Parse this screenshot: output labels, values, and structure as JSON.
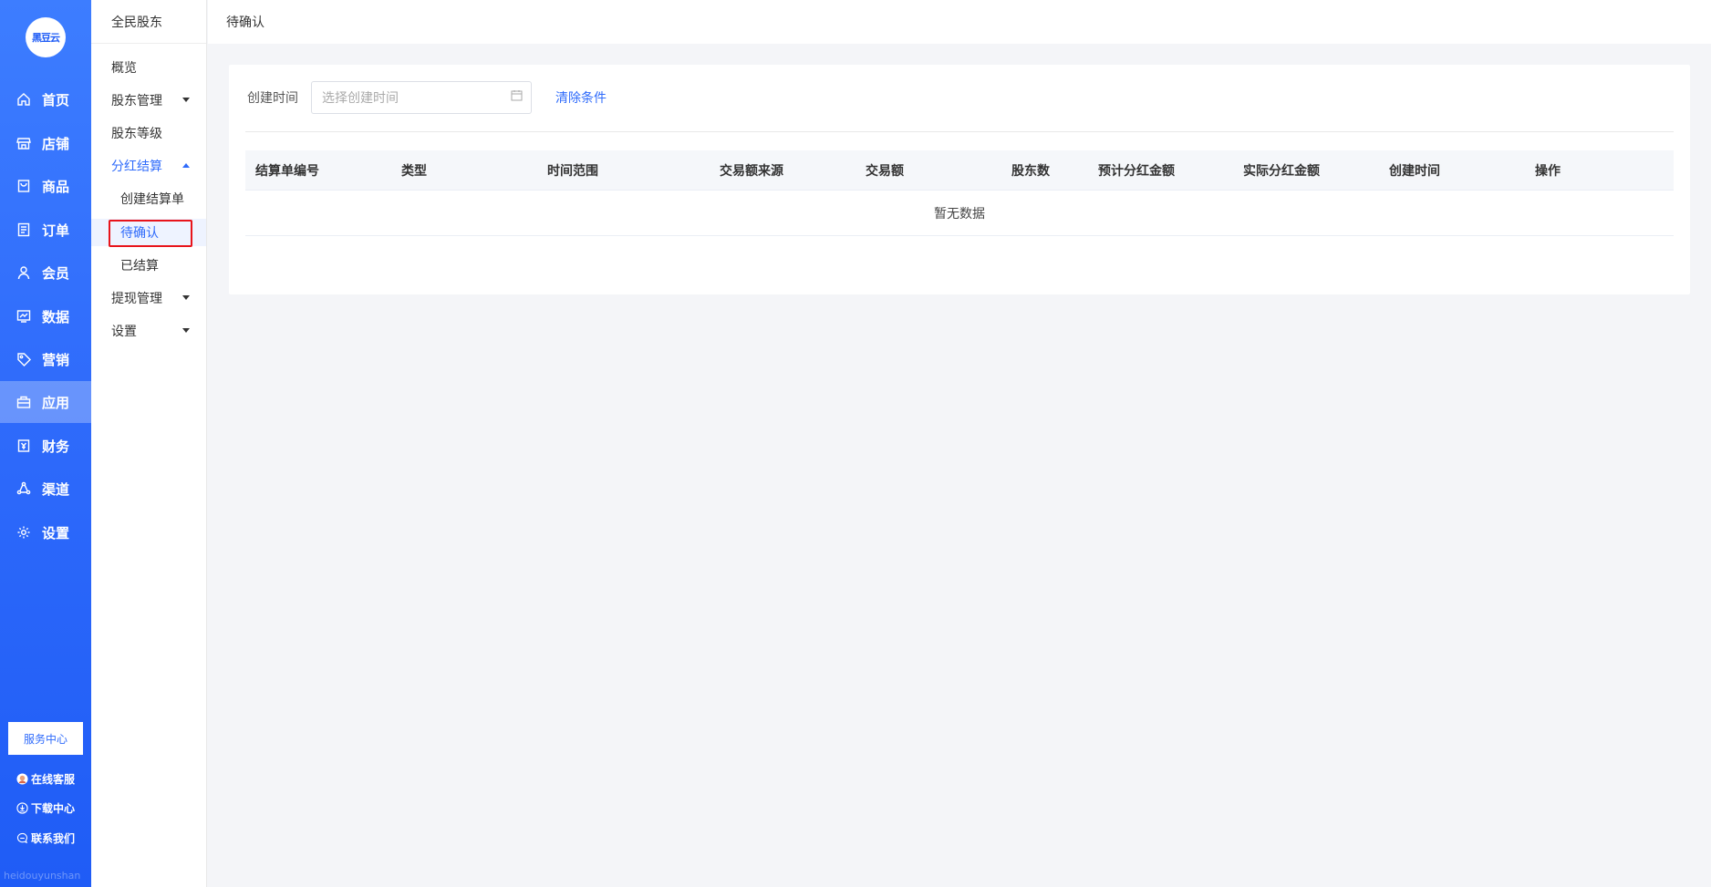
{
  "app": {
    "logo_text": "黑豆云",
    "nav": [
      {
        "label": "首页",
        "icon": "home-icon",
        "active": false
      },
      {
        "label": "店铺",
        "icon": "store-icon",
        "active": false
      },
      {
        "label": "商品",
        "icon": "goods-icon",
        "active": false
      },
      {
        "label": "订单",
        "icon": "order-icon",
        "active": false
      },
      {
        "label": "会员",
        "icon": "member-icon",
        "active": false
      },
      {
        "label": "数据",
        "icon": "chart-icon",
        "active": false
      },
      {
        "label": "营销",
        "icon": "tag-icon",
        "active": false
      },
      {
        "label": "应用",
        "icon": "app-icon",
        "active": true
      },
      {
        "label": "财务",
        "icon": "finance-icon",
        "active": false
      },
      {
        "label": "渠道",
        "icon": "channel-icon",
        "active": false
      },
      {
        "label": "设置",
        "icon": "gear-icon",
        "active": false
      }
    ],
    "service_center": "服务中心",
    "help_links": [
      {
        "label": "在线客服",
        "icon": "avatar-icon"
      },
      {
        "label": "下载中心",
        "icon": "download-icon"
      },
      {
        "label": "联系我们",
        "icon": "chat-icon"
      }
    ],
    "watermark": "heidouyunshan"
  },
  "submenu": {
    "title": "全民股东",
    "items": [
      {
        "label": "概览"
      },
      {
        "label": "股东管理",
        "caret": "down"
      },
      {
        "label": "股东等级"
      },
      {
        "label": "分红结算",
        "caret": "up",
        "expanded": true
      },
      {
        "label": "创建结算单",
        "child": true
      },
      {
        "label": "待确认",
        "child": true,
        "selected": true
      },
      {
        "label": "已结算",
        "child": true
      },
      {
        "label": "提现管理",
        "caret": "down"
      },
      {
        "label": "设置",
        "caret": "down"
      }
    ]
  },
  "header": {
    "breadcrumb": "待确认"
  },
  "filter": {
    "label": "创建时间",
    "date_placeholder": "选择创建时间",
    "clear_label": "清除条件"
  },
  "table": {
    "columns": [
      "结算单编号",
      "类型",
      "时间范围",
      "交易额来源",
      "交易额",
      "股东数",
      "预计分红金额",
      "实际分红金额",
      "创建时间",
      "操作"
    ],
    "rows": [],
    "empty_text": "暂无数据"
  },
  "colors": {
    "accent": "#2f6bfb",
    "highlight_border": "#e8141b"
  }
}
